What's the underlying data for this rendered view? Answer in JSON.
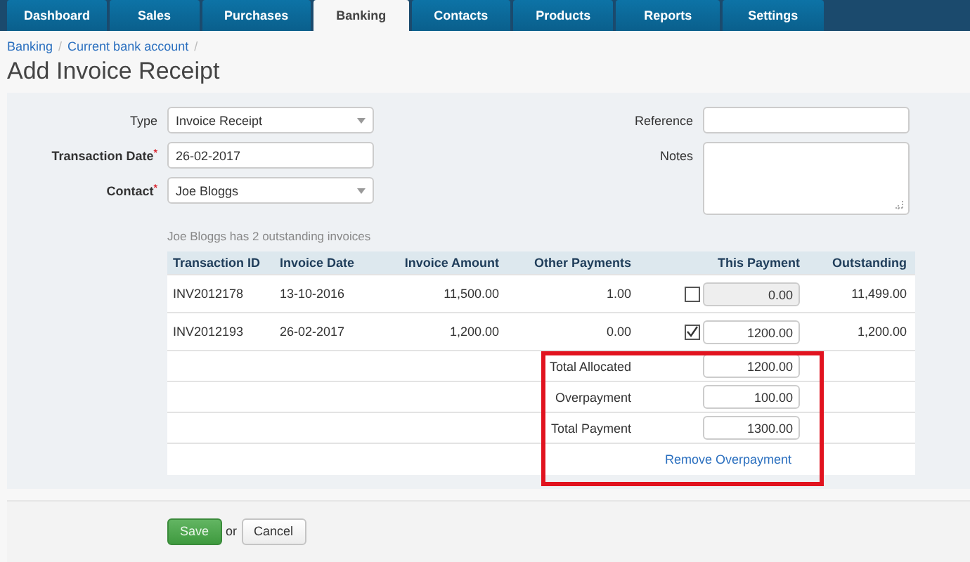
{
  "nav": {
    "tabs": [
      {
        "label": "Dashboard",
        "selected": false
      },
      {
        "label": "Sales",
        "selected": false
      },
      {
        "label": "Purchases",
        "selected": false
      },
      {
        "label": "Banking",
        "selected": true
      },
      {
        "label": "Contacts",
        "selected": false
      },
      {
        "label": "Products",
        "selected": false
      },
      {
        "label": "Reports",
        "selected": false
      },
      {
        "label": "Settings",
        "selected": false
      }
    ]
  },
  "breadcrumb": [
    {
      "label": "Banking",
      "separator": "/"
    },
    {
      "label": "Current bank account",
      "separator": "/"
    }
  ],
  "title": "Add Invoice Receipt",
  "form": {
    "left": [
      {
        "label": "Type",
        "kind": "select",
        "value": "Invoice Receipt"
      },
      {
        "label": "Transaction Date",
        "required_mark": "*",
        "kind": "text",
        "value": "26-02-2017"
      },
      {
        "label": "Contact",
        "required_mark": "*",
        "kind": "select",
        "value": "Joe Bloggs"
      }
    ],
    "right": [
      {
        "label": "Reference",
        "kind": "text"
      },
      {
        "label": "Notes",
        "kind": "textarea"
      }
    ],
    "hint": "Joe Bloggs has 2 outstanding invoices"
  },
  "table": {
    "columns": [
      "Transaction ID",
      "Invoice Date",
      "Invoice Amount",
      "Other Payments",
      "This Payment",
      "Outstanding"
    ],
    "rows": [
      {
        "id": "INV2012178",
        "date": "13-10-2016",
        "amount": "11,500.00",
        "other": "1.00",
        "checked": false,
        "payment": "0.00",
        "outstanding": "11,499.00"
      },
      {
        "id": "INV2012193",
        "date": "26-02-2017",
        "amount": "1,200.00",
        "other": "0.00",
        "checked": true,
        "payment": "1200.00",
        "outstanding": "1,200.00"
      }
    ],
    "totals": [
      {
        "label": "Total Allocated",
        "value": "1200.00"
      },
      {
        "label": "Overpayment",
        "value": "100.00"
      },
      {
        "label": "Total Payment",
        "value": "1300.00"
      }
    ],
    "remove_link": "Remove Overpayment",
    "totals_highlighted": true
  },
  "actions": {
    "save": "Save",
    "or": "or",
    "cancel": "Cancel"
  }
}
